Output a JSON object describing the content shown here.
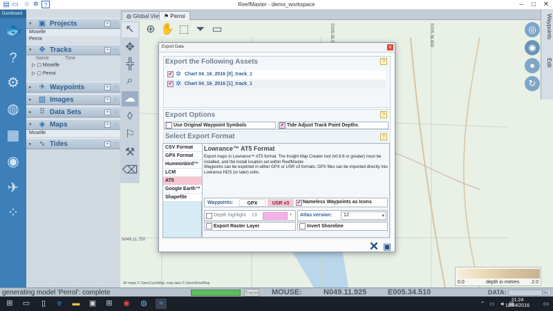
{
  "window": {
    "title": "ReefMaster - demo_workspace",
    "quick_icons": [
      "map-folder-icon",
      "folder-icon",
      "star-icon",
      "gear-icon",
      "help-icon"
    ]
  },
  "rail": {
    "dashboard_label": "Dashboard"
  },
  "panel": {
    "sections": {
      "projects": {
        "label": "Projects",
        "items": [
          "Moselle",
          "Perroi"
        ]
      },
      "tracks": {
        "label": "Tracks",
        "columns": [
          "Name",
          "Time"
        ],
        "items": [
          "Moselle",
          "Perroi"
        ]
      },
      "waypoints": {
        "label": "Waypoints"
      },
      "images": {
        "label": "Images"
      },
      "datasets": {
        "label": "Data Sets"
      },
      "maps": {
        "label": "Maps",
        "items": [
          "Moselle"
        ]
      },
      "tides": {
        "label": "Tides"
      }
    },
    "add_symbol": "+",
    "star_symbol": "☆"
  },
  "map": {
    "tabs": [
      "Global View",
      "Perroi"
    ],
    "right_tabs": [
      "Waypoints",
      "Edit"
    ],
    "coord_labels": [
      "E005.36.500",
      "E005.36.800",
      "N049.11.750"
    ],
    "attribution": "All maps © OpenCycleMap, map data © OpenStreetMap",
    "legend": {
      "min": "0.0",
      "max": "2.0",
      "label": "depth in metres"
    }
  },
  "status": {
    "message": "generating model 'Perrol': complete",
    "progress": 1.0,
    "trace_label": "Tracer",
    "mouse_label": "MOUSE:",
    "mouse_n": "N049.11.925",
    "mouse_e": "E005.34.510",
    "data_label": "DATA:",
    "data_toggle": "On"
  },
  "taskbar": {
    "time": "21:24",
    "date": "18/04/2016"
  },
  "dialog": {
    "title": "Export Data",
    "close": "x",
    "help": "?",
    "assets": {
      "heading": "Export the Following Assets",
      "items": [
        "Chart 04_16_2016 [0]_track_1",
        "Chart 04_16_2016 [1]_track_1"
      ]
    },
    "options": {
      "heading": "Export Options",
      "use_original_symbols": {
        "label": "Use Original Waypoint Symbols",
        "checked": false
      },
      "tide_adjust": {
        "label": "Tide Adjust Track Point Depths",
        "checked": true
      }
    },
    "format": {
      "heading": "Select Export Format",
      "list": [
        "CSV Format",
        "GPX Format",
        "Humminbird™",
        "LCM",
        "AT5",
        "Google Earth™",
        "Shapefile"
      ],
      "selected": "AT5",
      "title": "Lowrance™ AT5 Format",
      "description_1": "Export maps in Lowrance™ AT5 format. The Insight Map Creator tool (v0.6.6 or greater) must be installed, and the install location set within ReefMaster.",
      "description_2": "Waypoints can be exported in either GPX or USR v3 formats. GPX files can be imported directly into Lowrance HDS (or later) units.",
      "waypoints_label": "Waypoints:",
      "gpx": "GPX",
      "usr": "USR v3",
      "nameless": {
        "label": "Nameless Waypoints as Icons",
        "checked": true
      },
      "depth_highlight": {
        "label": "Depth highlight",
        "value": "13",
        "checked": false,
        "color": "#f7b0e8"
      },
      "atlas_label": "Atlas version:",
      "atlas_value": "12",
      "export_raster": {
        "label": "Export Raster Layer",
        "checked": false
      },
      "invert_shoreline": {
        "label": "Invert Shoreline",
        "checked": false
      }
    },
    "colors": {
      "accent": "#2e5e96",
      "selected_format": "#f7c6d1",
      "usr_selected": "#f7c6d1"
    }
  }
}
